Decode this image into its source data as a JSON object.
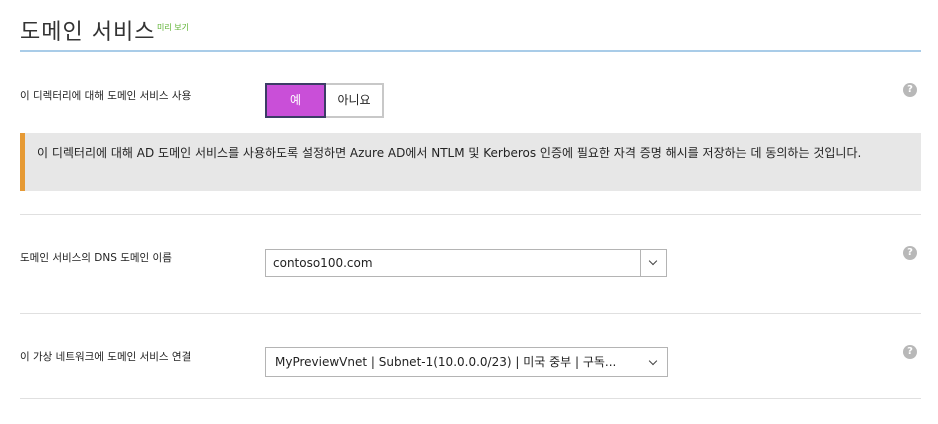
{
  "header": {
    "title": "도메인 서비스",
    "preview_badge": "미리 보기"
  },
  "enable_row": {
    "label": "이 디렉터리에 대해 도메인 서비스 사용",
    "toggle_yes": "예",
    "toggle_no": "아니요",
    "selected": "예"
  },
  "notice": {
    "text": "이 디렉터리에 대해 AD 도메인 서비스를 사용하도록 설정하면 Azure AD에서 NTLM 및 Kerberos 인증에 필요한 자격 증명 해시를 저장하는 데 동의하는 것입니다."
  },
  "dns_row": {
    "label": "도메인 서비스의 DNS 도메인 이름",
    "value": "contoso100.com"
  },
  "vnet_row": {
    "label": "이 가상 네트워크에 도메인 서비스 연결",
    "value": "MyPreviewVnet | Subnet-1(10.0.0.0/23) | 미국 중부 | 구독..."
  },
  "help_icon_glyph": "?",
  "colors": {
    "toggle_selected": "#c94fd8",
    "notice_accent": "#e69a35",
    "header_rule": "#a9cce8",
    "preview_badge": "#5bb12f"
  }
}
